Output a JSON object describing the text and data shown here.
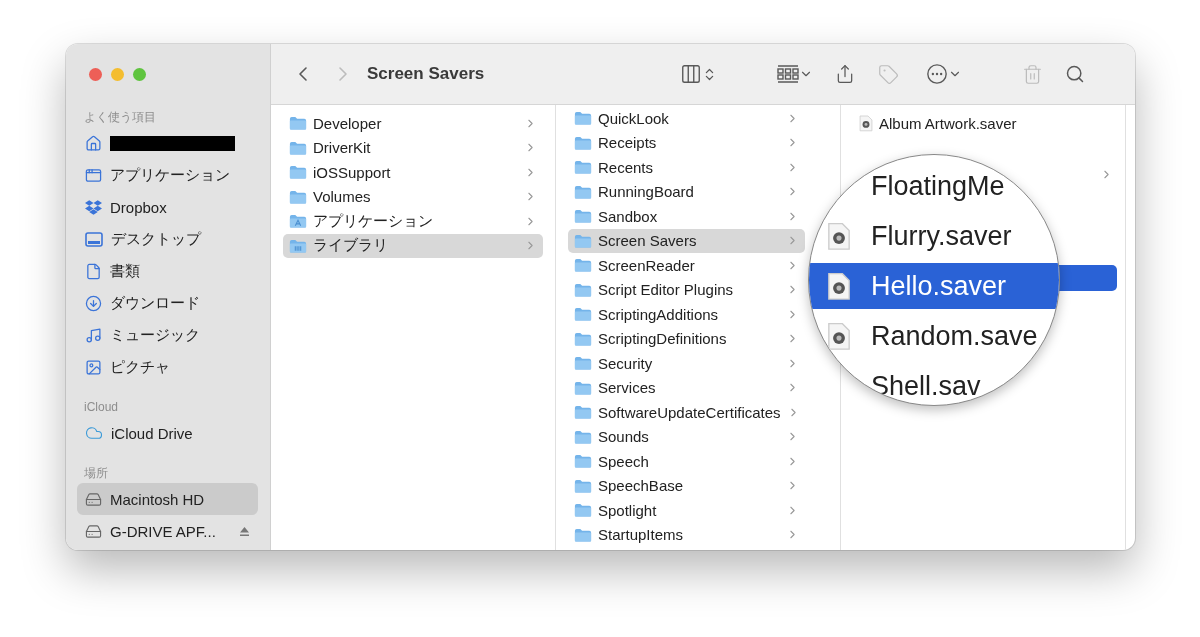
{
  "window": {
    "title": "Screen Savers"
  },
  "sidebar": {
    "sections": [
      {
        "header": "よく使う項目",
        "items": [
          {
            "kind": "home",
            "redacted": true,
            "selected": false
          },
          {
            "label": "アプリケーション",
            "kind": "apps",
            "selected": false
          },
          {
            "label": "Dropbox",
            "kind": "dropbox",
            "selected": false
          },
          {
            "label": "デスクトップ",
            "kind": "desktop",
            "selected": false
          },
          {
            "label": "書類",
            "kind": "document",
            "selected": false
          },
          {
            "label": "ダウンロード",
            "kind": "download",
            "selected": false
          },
          {
            "label": "ミュージック",
            "kind": "music",
            "selected": false
          },
          {
            "label": "ピクチャ",
            "kind": "picture",
            "selected": false
          }
        ]
      },
      {
        "header": "iCloud",
        "items": [
          {
            "label": "iCloud Drive",
            "kind": "cloud",
            "selected": false
          }
        ]
      },
      {
        "header": "場所",
        "items": [
          {
            "label": "Macintosh HD",
            "kind": "disk",
            "selected": true
          },
          {
            "label": "G-DRIVE APF...",
            "kind": "disk",
            "eject": true,
            "selected": false
          }
        ]
      }
    ]
  },
  "columns": [
    {
      "items": [
        {
          "name": "Developer",
          "kind": "folder",
          "selected": false
        },
        {
          "name": "DriverKit",
          "kind": "folder",
          "selected": false
        },
        {
          "name": "iOSSupport",
          "kind": "folder",
          "selected": false
        },
        {
          "name": "Volumes",
          "kind": "folder",
          "selected": false
        },
        {
          "name": "アプリケーション",
          "kind": "apps-folder",
          "selected": false
        },
        {
          "name": "ライブラリ",
          "kind": "library-folder",
          "selected": true
        }
      ]
    },
    {
      "scrolled": true,
      "items": [
        {
          "name": "QuickLook",
          "kind": "folder",
          "selected": false
        },
        {
          "name": "Receipts",
          "kind": "folder",
          "selected": false
        },
        {
          "name": "Recents",
          "kind": "folder",
          "selected": false
        },
        {
          "name": "RunningBoard",
          "kind": "folder",
          "selected": false
        },
        {
          "name": "Sandbox",
          "kind": "folder",
          "selected": false
        },
        {
          "name": "Screen Savers",
          "kind": "folder",
          "selected": true
        },
        {
          "name": "ScreenReader",
          "kind": "folder",
          "selected": false
        },
        {
          "name": "Script Editor Plugins",
          "kind": "folder",
          "selected": false
        },
        {
          "name": "ScriptingAdditions",
          "kind": "folder",
          "selected": false
        },
        {
          "name": "ScriptingDefinitions",
          "kind": "folder",
          "selected": false
        },
        {
          "name": "Security",
          "kind": "folder",
          "selected": false
        },
        {
          "name": "Services",
          "kind": "folder",
          "selected": false
        },
        {
          "name": "SoftwareUpdateCertificates",
          "kind": "folder",
          "selected": false
        },
        {
          "name": "Sounds",
          "kind": "folder",
          "selected": false
        },
        {
          "name": "Speech",
          "kind": "folder",
          "selected": false
        },
        {
          "name": "SpeechBase",
          "kind": "folder",
          "selected": false
        },
        {
          "name": "Spotlight",
          "kind": "folder",
          "selected": false
        },
        {
          "name": "StartupItems",
          "kind": "folder",
          "selected": false
        }
      ]
    },
    {
      "items": [
        {
          "name": "Album Artwork.saver",
          "kind": "saver",
          "selected": false
        }
      ]
    }
  ],
  "magnifier": {
    "items": [
      {
        "name": "FloatingMe",
        "selected": false
      },
      {
        "name": "Flurry.saver",
        "kind": "saver",
        "selected": false
      },
      {
        "name": "Hello.saver",
        "kind": "saver",
        "selected": true
      },
      {
        "name": "Random.save",
        "kind": "saver",
        "selected": false
      },
      {
        "name": "Shell.sav",
        "selected": false
      }
    ]
  }
}
